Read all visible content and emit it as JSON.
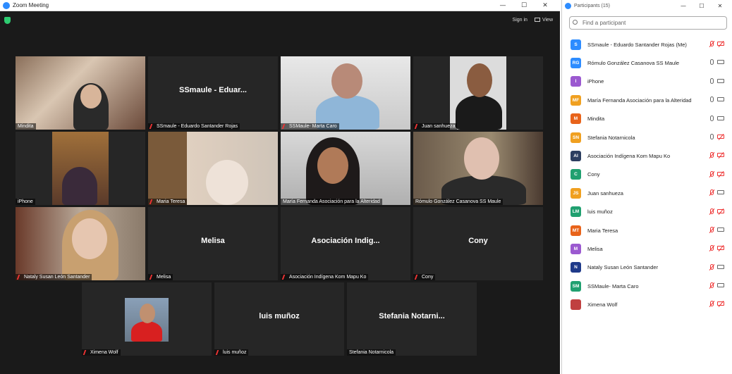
{
  "window": {
    "title": "Zoom Meeting",
    "controls": [
      "—",
      "☐",
      "✕"
    ]
  },
  "toolbar": {
    "signin_label": "Sign in",
    "view_label": "View"
  },
  "tiles": [
    {
      "name": "Mindita",
      "muted": false,
      "center": ""
    },
    {
      "name": "SSmaule - Eduardo Santander Rojas",
      "muted": true,
      "center": "SSmaule - Eduar..."
    },
    {
      "name": "SSMaule- Marta Caro",
      "muted": true,
      "center": ""
    },
    {
      "name": "Juan sanhueza",
      "muted": true,
      "center": ""
    },
    {
      "name": "iPhone",
      "muted": false,
      "center": ""
    },
    {
      "name": "Maria Teresa",
      "muted": true,
      "center": ""
    },
    {
      "name": "María Fernanda Asociación para la Alteridad",
      "muted": false,
      "center": ""
    },
    {
      "name": "Rómulo González Casanova SS Maule",
      "muted": false,
      "center": ""
    },
    {
      "name": "Nataly Susan León Santander",
      "muted": true,
      "center": ""
    },
    {
      "name": "Melisa",
      "muted": true,
      "center": "Melisa"
    },
    {
      "name": "Asociación Indígena Kom Mapu Ko",
      "muted": true,
      "center": "Asociación Indig..."
    },
    {
      "name": "Cony",
      "muted": true,
      "center": "Cony"
    },
    {
      "name": "Ximena Wolf",
      "muted": true,
      "center": ""
    },
    {
      "name": "luis muñoz",
      "muted": true,
      "center": "luis muñoz"
    },
    {
      "name": "Stefania Notarnicola",
      "muted": false,
      "center": "Stefania Notarni..."
    }
  ],
  "panel": {
    "title": "Participants (15)",
    "search_placeholder": "Find a participant",
    "participants": [
      {
        "initials": "S",
        "name": "SSmaule - Eduardo Santander Rojas (Me)",
        "color": "#2d8cff",
        "mic": "off",
        "cam": "off"
      },
      {
        "initials": "RG",
        "name": "Rómulo González Casanova SS Maule",
        "color": "#2d8cff",
        "mic": "on",
        "cam": "on"
      },
      {
        "initials": "I",
        "name": "iPhone",
        "color": "#9b59d0",
        "mic": "on",
        "cam": "on"
      },
      {
        "initials": "MF",
        "name": "María Fernanda Asociación para la Alteridad",
        "color": "#f0a020",
        "mic": "on",
        "cam": "on"
      },
      {
        "initials": "M",
        "name": "Mindita",
        "color": "#e8631a",
        "mic": "on",
        "cam": "on"
      },
      {
        "initials": "SN",
        "name": "Stefania Notarnicola",
        "color": "#f0a020",
        "mic": "on",
        "cam": "off"
      },
      {
        "initials": "AI",
        "name": "Asociación Indígena Kom Mapu Ko",
        "color": "#2c3e60",
        "mic": "off",
        "cam": "off"
      },
      {
        "initials": "C",
        "name": "Cony",
        "color": "#20a070",
        "mic": "off",
        "cam": "off"
      },
      {
        "initials": "JS",
        "name": "Juan sanhueza",
        "color": "#f0a020",
        "mic": "off",
        "cam": "on"
      },
      {
        "initials": "LM",
        "name": "luis muñoz",
        "color": "#20a070",
        "mic": "off",
        "cam": "off"
      },
      {
        "initials": "MT",
        "name": "Maria Teresa",
        "color": "#e8631a",
        "mic": "off",
        "cam": "on"
      },
      {
        "initials": "M",
        "name": "Melisa",
        "color": "#9b59d0",
        "mic": "off",
        "cam": "off"
      },
      {
        "initials": "N",
        "name": "Nataly Susan León Santander",
        "color": "#1f3a8a",
        "mic": "off",
        "cam": "on"
      },
      {
        "initials": "SM",
        "name": "SSMaule- Marta Caro",
        "color": "#20a070",
        "mic": "off",
        "cam": "on"
      },
      {
        "initials": "",
        "name": "Ximena Wolf",
        "color": "#c04040",
        "mic": "off",
        "cam": "off"
      }
    ]
  }
}
